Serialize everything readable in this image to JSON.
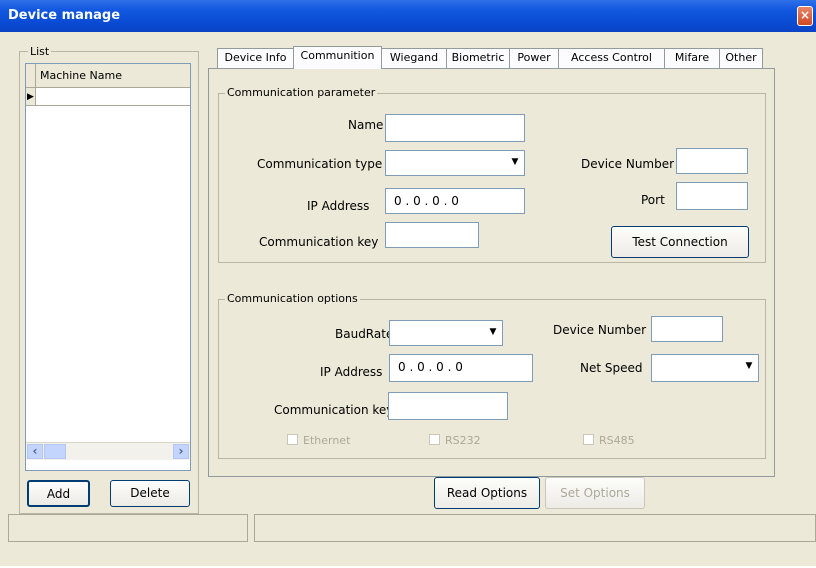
{
  "window": {
    "title": "Device manage",
    "close_label": "×"
  },
  "list": {
    "group_label": "List",
    "column_header": "Machine Name",
    "row_marker": "▶",
    "scroll_left": "‹",
    "scroll_right": "›",
    "add_label": "Add",
    "delete_label": "Delete"
  },
  "tabs": [
    {
      "label": "Device Info"
    },
    {
      "label": "Communition",
      "active": true
    },
    {
      "label": "Wiegand"
    },
    {
      "label": "Biometric"
    },
    {
      "label": "Power"
    },
    {
      "label": "Access Control"
    },
    {
      "label": "Mifare"
    },
    {
      "label": "Other"
    }
  ],
  "comm_param": {
    "group_label": "Communication parameter",
    "name_label": "Name",
    "name_value": "",
    "comm_type_label": "Communication type",
    "comm_type_value": "",
    "ip_label": "IP Address",
    "ip_value": "0 . 0 . 0 . 0",
    "key_label": "Communication key",
    "key_value": "",
    "device_number_label": "Device Number",
    "device_number_value": "",
    "port_label": "Port",
    "port_value": "",
    "test_button": "Test Connection"
  },
  "comm_options": {
    "group_label": "Communication options",
    "baud_label": "BaudRate",
    "baud_value": "",
    "ip_label": "IP Address",
    "ip_value": "0 . 0 . 0 . 0",
    "key_label": "Communication key",
    "key_value": "",
    "device_number_label": "Device Number",
    "device_number_value": "",
    "net_speed_label": "Net Speed",
    "net_speed_value": "",
    "ethernet_label": "Ethernet",
    "rs232_label": "RS232",
    "rs485_label": "RS485"
  },
  "actions": {
    "read_options": "Read Options",
    "set_options": "Set Options"
  },
  "icons": {
    "dropdown": "▼",
    "close": "close-icon",
    "row_pointer": "triangle-right-icon"
  }
}
